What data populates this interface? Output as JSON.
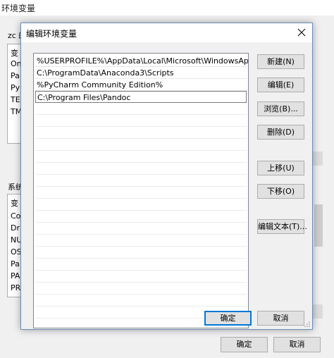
{
  "parent_window": {
    "title": "环境变量",
    "user_section_label": "zc 的",
    "system_section_label": "系统",
    "user_rows": [
      "变",
      "On",
      "Pa",
      "Py",
      "TE",
      "TM"
    ],
    "system_rows": [
      "变",
      "Co",
      "Dr",
      "NU",
      "OS",
      "Pa",
      "PA",
      "PR"
    ],
    "ok_label": "确定",
    "cancel_label": "取消"
  },
  "dialog": {
    "title": "编辑环境变量",
    "paths": [
      "%USERPROFILE%\\AppData\\Local\\Microsoft\\WindowsApps",
      "C:\\ProgramData\\Anaconda3\\Scripts",
      "%PyCharm Community Edition%",
      "C:\\Program Files\\Pandoc"
    ],
    "buttons": {
      "new": "新建(N)",
      "edit": "编辑(E)",
      "browse": "浏览(B)...",
      "delete": "删除(D)",
      "move_up": "上移(U)",
      "move_down": "下移(O)",
      "edit_text": "编辑文本(T)...",
      "ok": "确定",
      "cancel": "取消"
    }
  },
  "colors": {
    "accent": "#0078d7",
    "dialog_border": "#6b8fb5"
  }
}
